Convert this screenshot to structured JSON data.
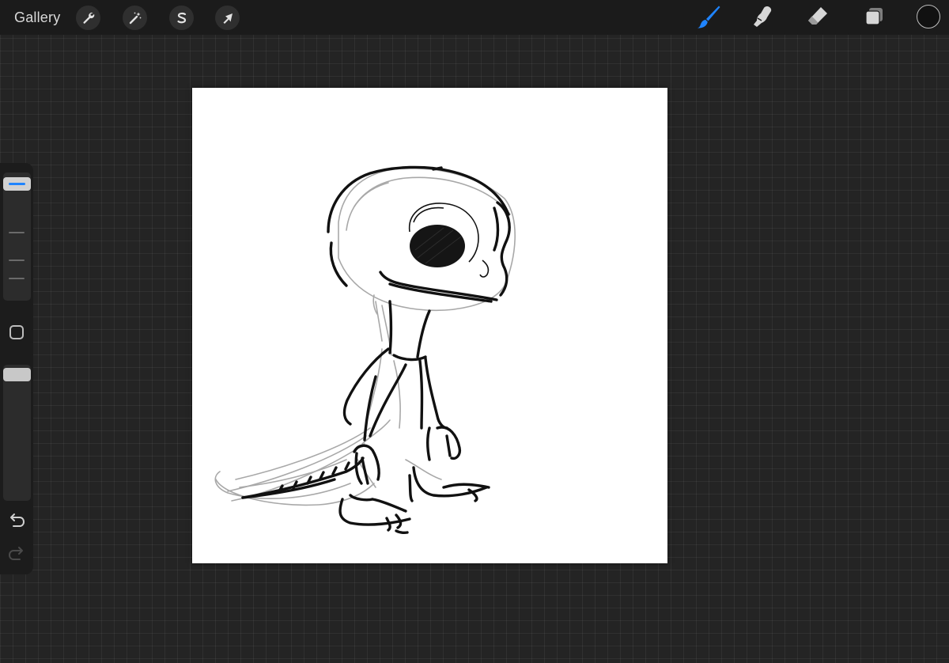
{
  "topbar": {
    "gallery_label": "Gallery",
    "left_tools": [
      {
        "name": "actions",
        "icon": "wrench-icon"
      },
      {
        "name": "adjustments",
        "icon": "magic-wand-icon"
      },
      {
        "name": "selection",
        "icon": "selection-s-icon"
      },
      {
        "name": "transform",
        "icon": "arrow-cursor-icon"
      }
    ],
    "right_tools": [
      {
        "name": "brush",
        "icon": "brush-icon",
        "active": true
      },
      {
        "name": "smudge",
        "icon": "smudge-finger-icon",
        "active": false
      },
      {
        "name": "eraser",
        "icon": "eraser-icon",
        "active": false
      },
      {
        "name": "layers",
        "icon": "layers-icon",
        "active": false
      }
    ],
    "current_color": "#111111"
  },
  "sidebar": {
    "brush_size_thumb_icon": "size-slider-thumb",
    "modify_button_icon": "square-modify-icon",
    "undo_icon": "undo-arrow-icon",
    "redo_icon": "redo-arrow-icon"
  },
  "colors": {
    "accent": "#1f84ff",
    "background": "#242424",
    "toolbar": "#1b1b1b",
    "canvas": "#ffffff"
  },
  "canvas": {
    "content": "lizard-character-pencil-sketch-icon"
  }
}
